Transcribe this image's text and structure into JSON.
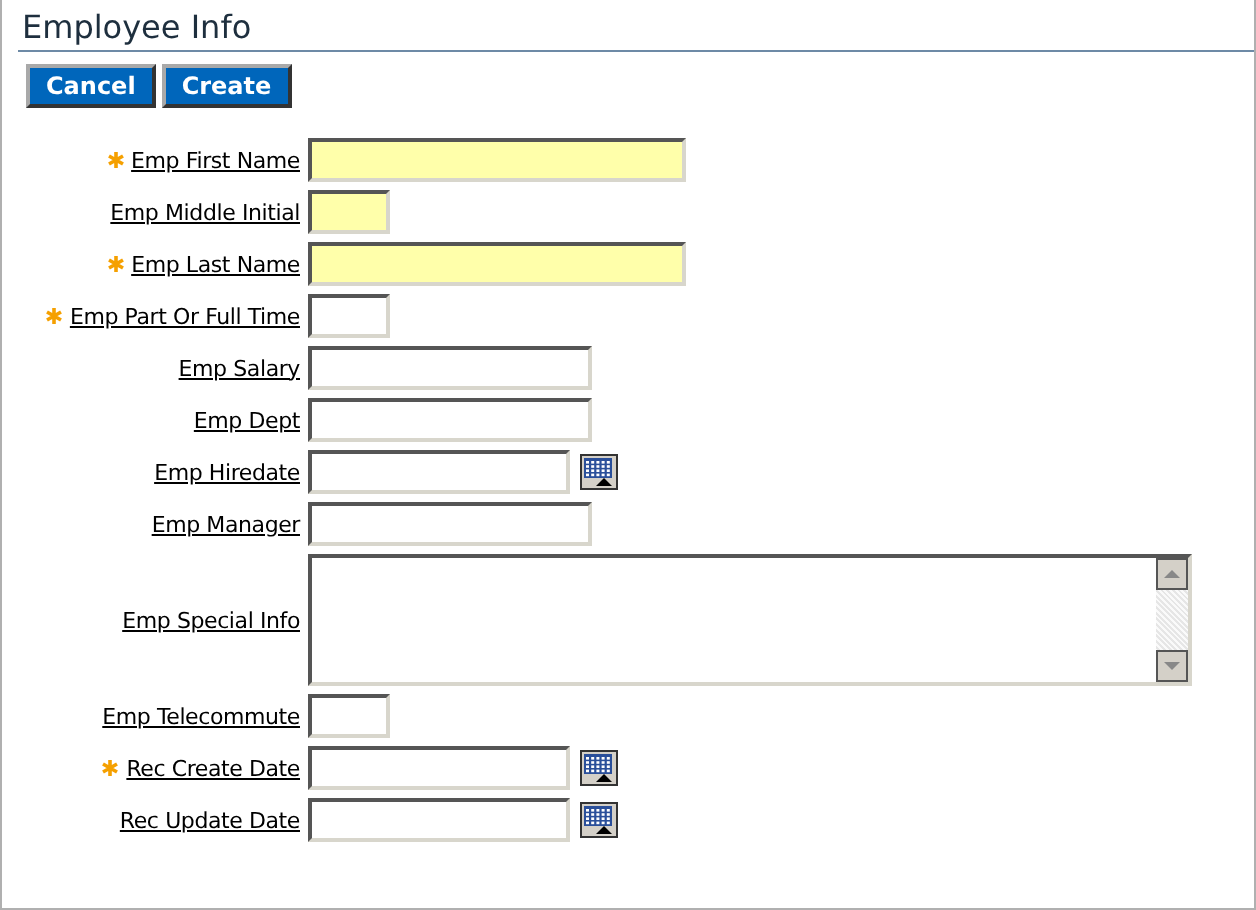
{
  "header": {
    "title": "Employee Info"
  },
  "buttons": [
    "Cancel",
    "Create"
  ],
  "fields": [
    {
      "label": "Emp First Name",
      "kind": "long",
      "required": true,
      "highlighted": true
    },
    {
      "label": "Emp Middle Initial",
      "kind": "short",
      "required": false,
      "highlighted": true
    },
    {
      "label": "Emp Last Name",
      "kind": "long",
      "required": true,
      "highlighted": true
    },
    {
      "label": "Emp Part Or Full Time",
      "kind": "short",
      "required": true,
      "highlighted": false
    },
    {
      "label": "Emp Salary",
      "kind": "text",
      "required": false,
      "highlighted": false
    },
    {
      "label": "Emp Dept",
      "kind": "text",
      "required": false,
      "highlighted": false
    },
    {
      "label": "Emp Hiredate",
      "kind": "date",
      "required": false,
      "highlighted": false
    },
    {
      "label": "Emp Manager",
      "kind": "text",
      "required": false,
      "highlighted": false
    },
    {
      "label": "Emp Special Info",
      "kind": "textarea",
      "required": false,
      "highlighted": false
    },
    {
      "label": "Emp Telecommute",
      "kind": "short",
      "required": false,
      "highlighted": false
    },
    {
      "label": "Rec Create Date",
      "kind": "date",
      "required": true,
      "highlighted": false
    },
    {
      "label": "Rec Update Date",
      "kind": "date",
      "required": false,
      "highlighted": false
    }
  ]
}
